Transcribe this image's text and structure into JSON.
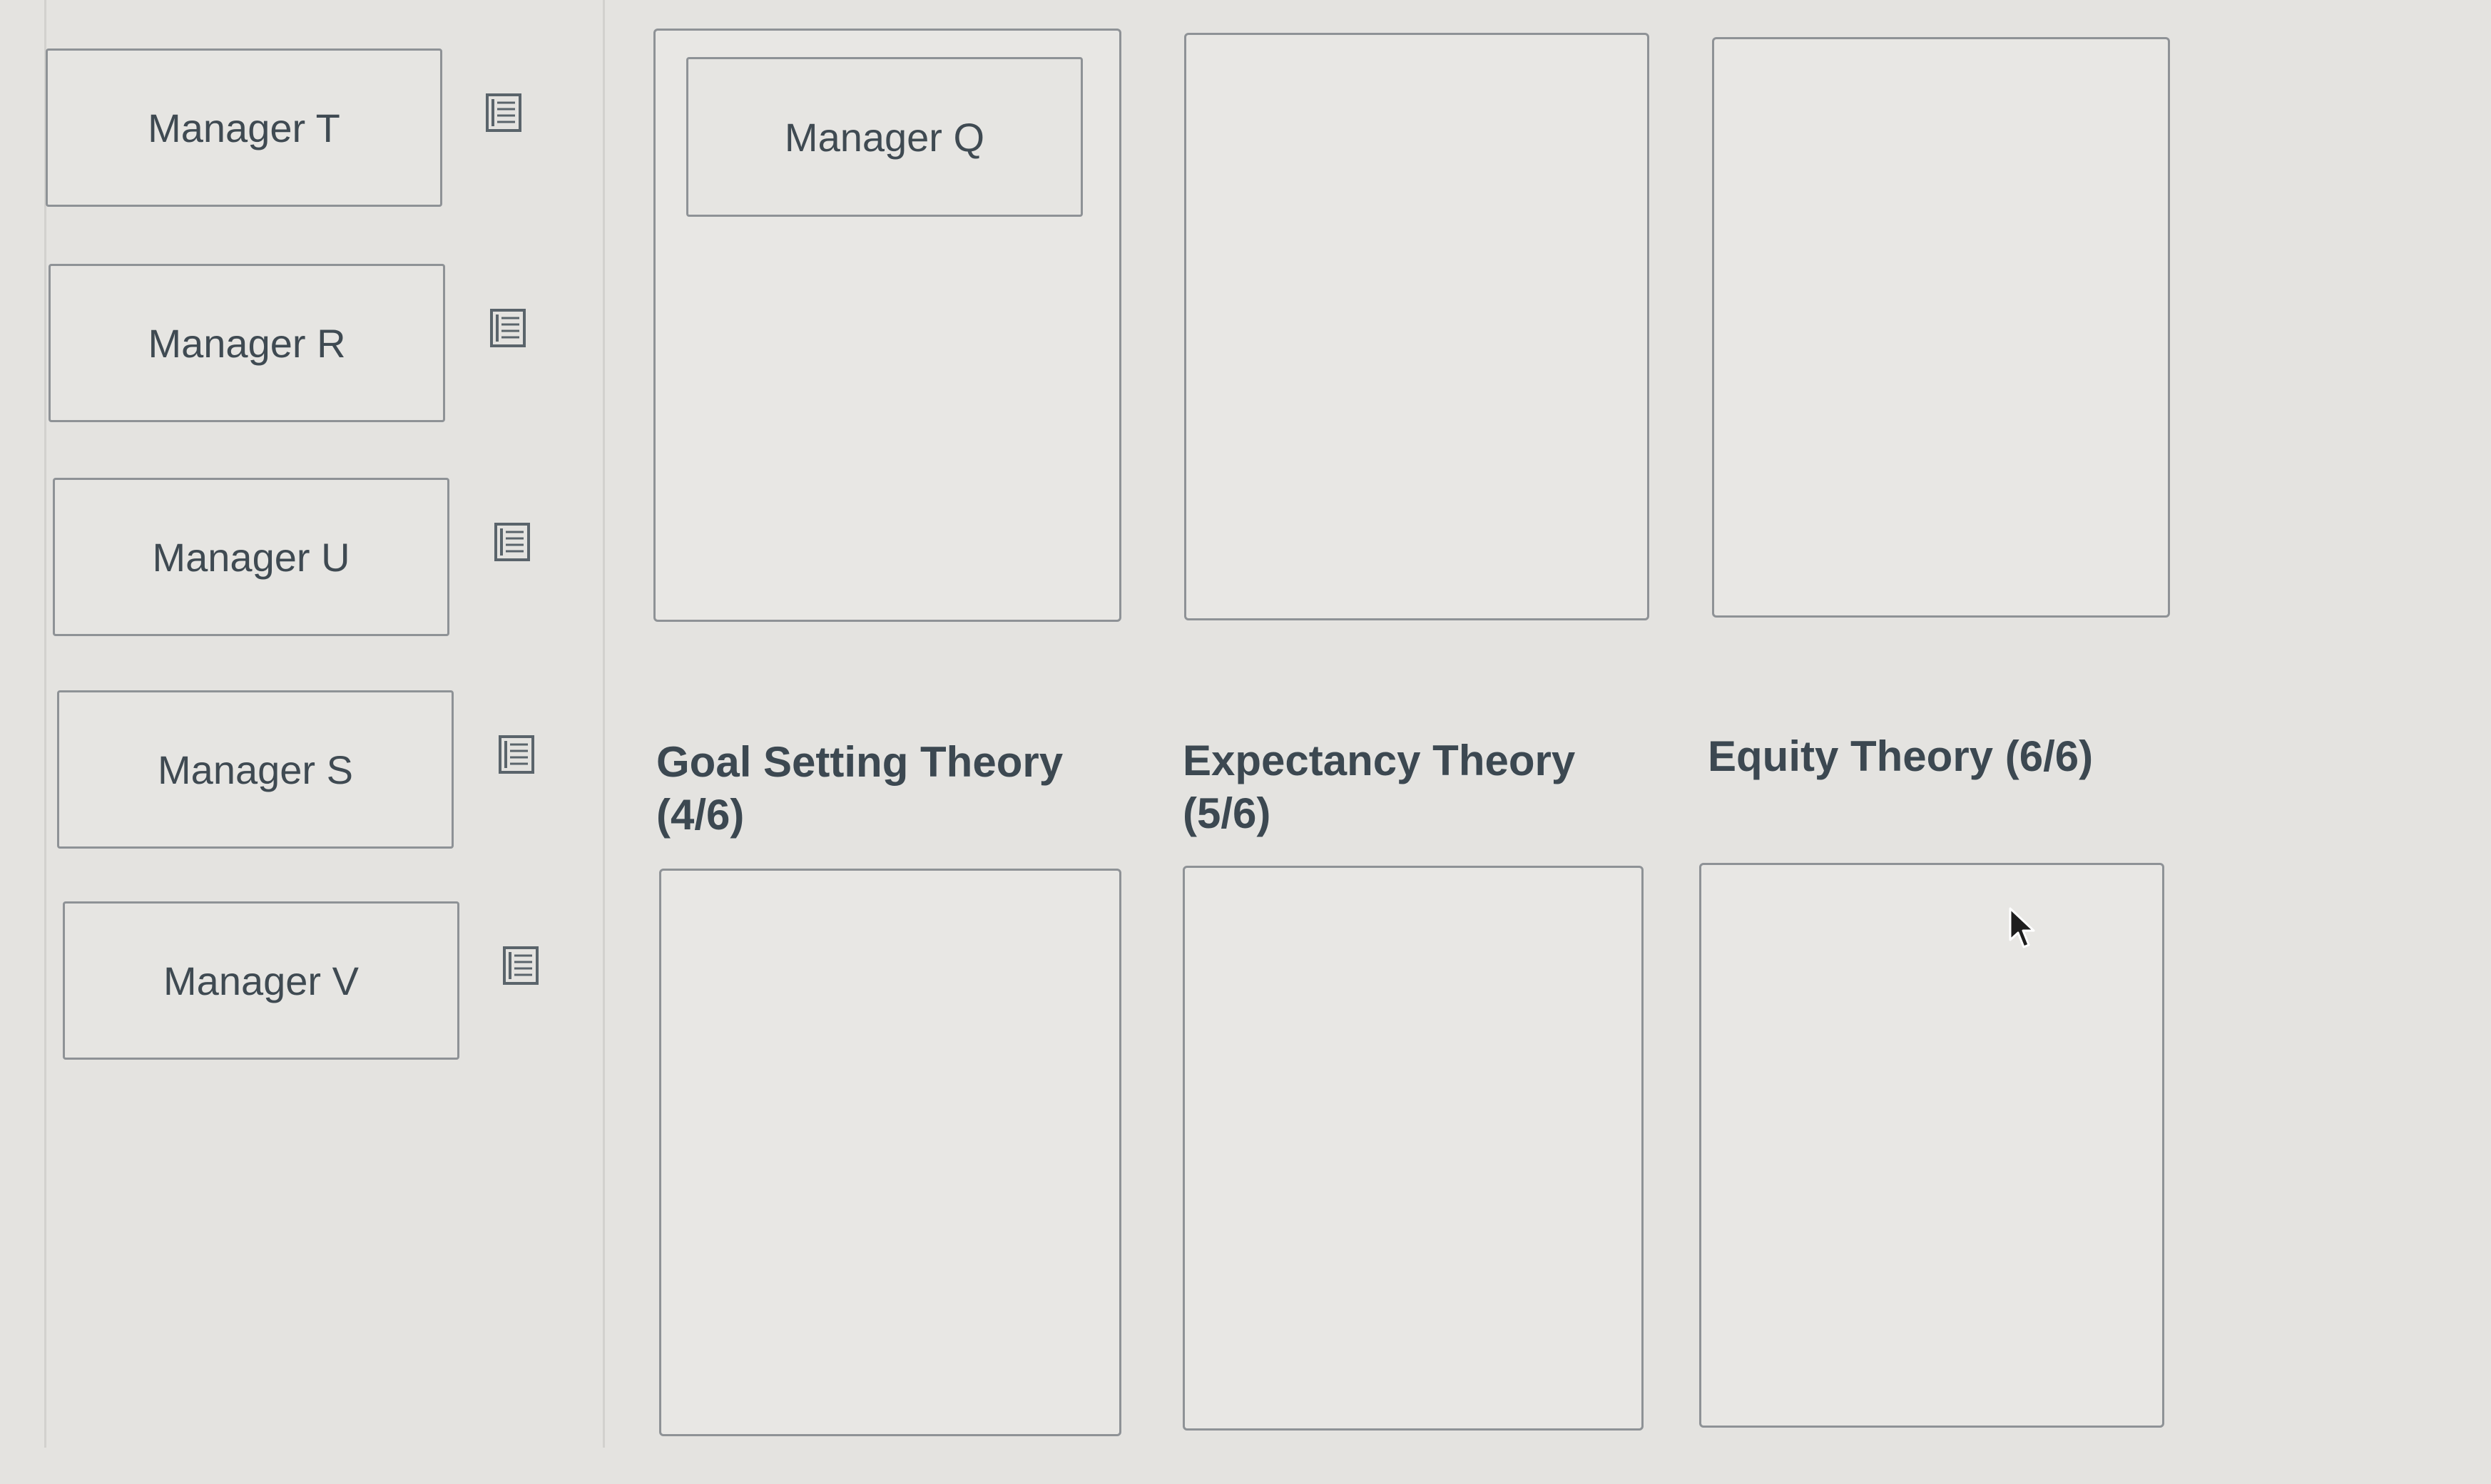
{
  "source_cards": [
    {
      "label": "Manager T"
    },
    {
      "label": "Manager R"
    },
    {
      "label": "Manager U"
    },
    {
      "label": "Manager S"
    },
    {
      "label": "Manager V"
    }
  ],
  "categories": [
    {
      "title": "Goal Setting Theory",
      "count": "(4/6)",
      "placed": [
        "Manager Q"
      ]
    },
    {
      "title": "Expectancy Theory",
      "count": "(5/6)",
      "placed": []
    },
    {
      "title": "Equity Theory (6/6)",
      "count": "",
      "placed": []
    }
  ],
  "icons": {
    "card_note": "note-list-icon",
    "cursor": "mouse-pointer-icon"
  }
}
